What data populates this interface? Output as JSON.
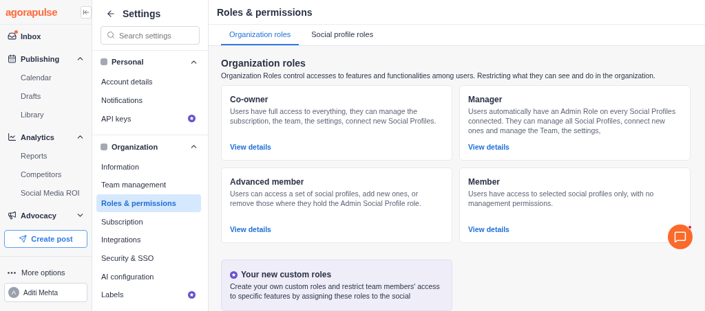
{
  "brand": {
    "name": "agorapulse"
  },
  "nav": [
    {
      "kind": "link",
      "label": "Inbox",
      "notify": true
    },
    {
      "kind": "group",
      "label": "Publishing",
      "expanded": true,
      "children": [
        {
          "label": "Calendar"
        },
        {
          "label": "Drafts"
        },
        {
          "label": "Library"
        }
      ]
    },
    {
      "kind": "group",
      "label": "Analytics",
      "expanded": true,
      "children": [
        {
          "label": "Reports"
        },
        {
          "label": "Competitors"
        },
        {
          "label": "Social Media ROI"
        }
      ]
    },
    {
      "kind": "group",
      "label": "Advocacy",
      "expanded": false
    }
  ],
  "create_button": "Create post",
  "more_options": "More options",
  "user": {
    "initial": "A",
    "name": "Aditi Mehta"
  },
  "settings": {
    "title": "Settings",
    "search": {
      "placeholder": "Search settings"
    },
    "sections": [
      {
        "label": "Personal",
        "expanded": true,
        "items": [
          {
            "label": "Account details",
            "selected": false,
            "premium": false
          },
          {
            "label": "Notifications",
            "selected": false,
            "premium": false
          },
          {
            "label": "API keys",
            "selected": false,
            "premium": true
          }
        ]
      },
      {
        "label": "Organization",
        "expanded": true,
        "items": [
          {
            "label": "Information",
            "selected": false,
            "premium": false
          },
          {
            "label": "Team management",
            "selected": false,
            "premium": false
          },
          {
            "label": "Roles & permissions",
            "selected": true,
            "premium": false
          },
          {
            "label": "Subscription",
            "selected": false,
            "premium": false
          },
          {
            "label": "Integrations",
            "selected": false,
            "premium": false
          },
          {
            "label": "Security & SSO",
            "selected": false,
            "premium": false
          },
          {
            "label": "AI configuration",
            "selected": false,
            "premium": false
          },
          {
            "label": "Labels",
            "selected": false,
            "premium": true
          }
        ]
      }
    ]
  },
  "page": {
    "title": "Roles & permissions",
    "tabs": [
      {
        "label": "Organization roles",
        "selected": true
      },
      {
        "label": "Social profile roles",
        "selected": false
      }
    ],
    "heading": "Organization roles",
    "description": "Organization Roles control accesses to features and functionalities among users. Restricting what they can see and do in the organization.",
    "roles": [
      {
        "title": "Co-owner",
        "text": "Users have full access to everything, they can manage the subscription, the team, the settings, connect new Social Profiles.",
        "link": "View details"
      },
      {
        "title": "Manager",
        "text": "Users automatically have an Admin Role on every Social Profiles connected. They can manage all Social Profiles, connect new ones and manage the Team, the settings,",
        "link": "View details"
      },
      {
        "title": "Advanced member",
        "text": "Users can access a set of social profiles, add new ones, or remove those where they hold the Admin Social Profile role.",
        "link": "View details"
      },
      {
        "title": "Member",
        "text": "Users have access to selected social profiles only, with no management permissions.",
        "link": "View details"
      }
    ],
    "custom": {
      "title": "Your new custom roles",
      "text": "Create your own custom roles and restrict team members' access to specific features by assigning these roles to the social"
    }
  },
  "chat": {
    "unread": true
  }
}
